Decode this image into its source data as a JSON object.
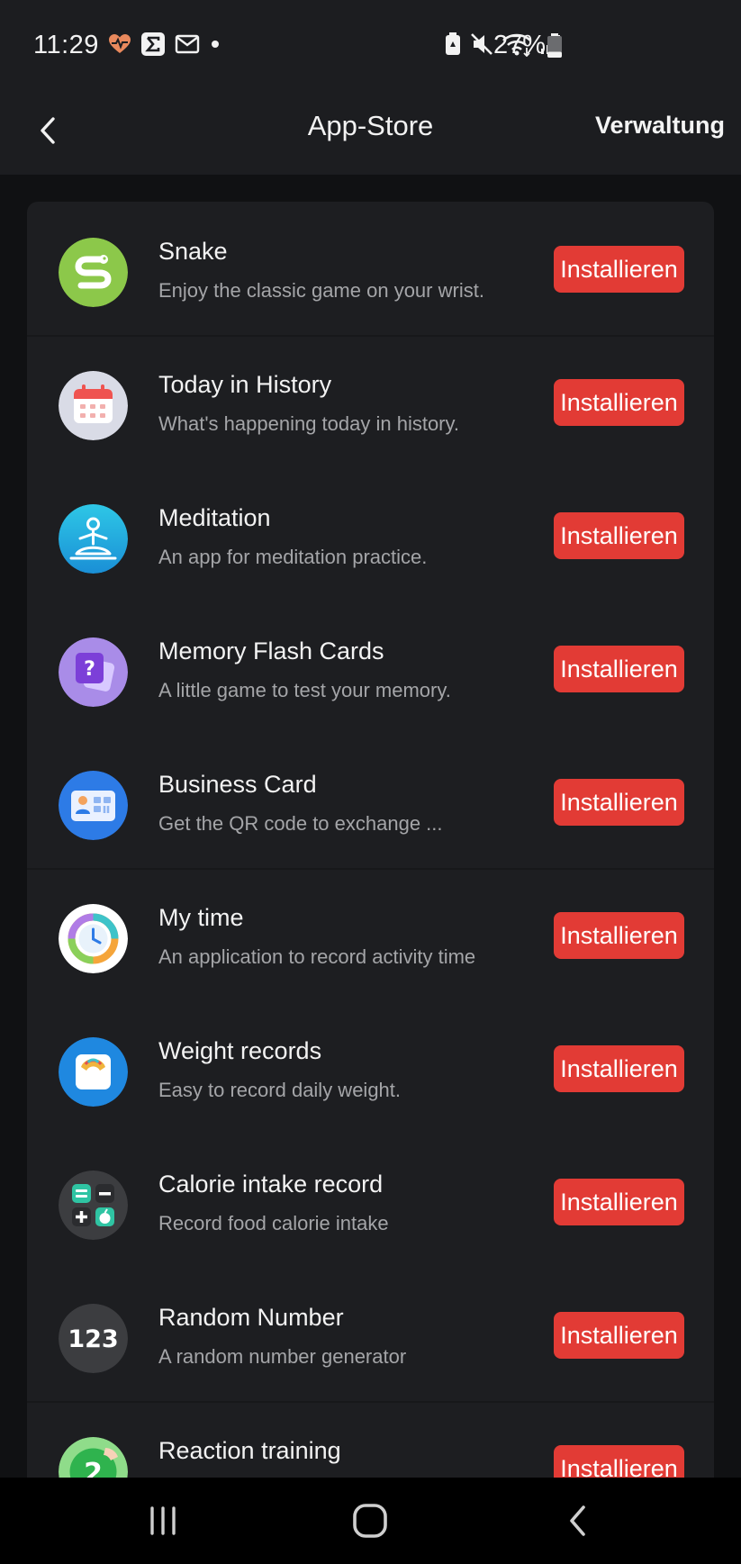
{
  "status_bar": {
    "time": "11:29",
    "battery_percent": "27%",
    "battery_level": 0.27,
    "left_icons": [
      "heart-rate-icon",
      "sigma-app-icon",
      "mail-icon",
      "dot-icon"
    ],
    "right_icons": [
      "battery-saver-icon",
      "mute-icon",
      "wifi-icon",
      "signal-icon"
    ]
  },
  "header": {
    "title": "App-Store",
    "manage_label": "Verwaltung",
    "back_icon": "chevron-left-icon"
  },
  "colors": {
    "accent": "#e23b35",
    "background": "#101113",
    "card": "#1d1e21",
    "header": "#1c1d20"
  },
  "apps": [
    {
      "name": "Snake",
      "description": "Enjoy the classic game on your wrist.",
      "install_label": "Installieren",
      "icon": "snake-app-icon"
    },
    {
      "name": "Today in History",
      "description": "What's happening today in history.",
      "install_label": "Installieren",
      "icon": "calendar-app-icon"
    },
    {
      "name": "Meditation",
      "description": "An app for meditation practice.",
      "install_label": "Installieren",
      "icon": "meditation-app-icon"
    },
    {
      "name": "Memory Flash Cards",
      "description": "A little game to test your memory.",
      "install_label": "Installieren",
      "icon": "flash-cards-app-icon"
    },
    {
      "name": "Business Card",
      "description": "Get the QR code to exchange ...",
      "install_label": "Installieren",
      "icon": "business-card-app-icon"
    },
    {
      "name": "My time",
      "description": "An application to record activity time",
      "install_label": "Installieren",
      "icon": "clock-app-icon"
    },
    {
      "name": "Weight records",
      "description": "Easy to record daily weight.",
      "install_label": "Installieren",
      "icon": "scale-app-icon"
    },
    {
      "name": "Calorie intake record",
      "description": "Record food calorie intake",
      "install_label": "Installieren",
      "icon": "calorie-app-icon"
    },
    {
      "name": "Random Number",
      "description": "A random number generator",
      "install_label": "Installieren",
      "icon": "random-number-app-icon",
      "icon_text": "123"
    },
    {
      "name": "Reaction training",
      "description": "",
      "install_label": "Installieren",
      "icon": "reaction-app-icon",
      "icon_text": "2"
    }
  ],
  "nav_bar": {
    "buttons": [
      "recent-apps-icon",
      "home-icon",
      "back-icon"
    ]
  }
}
